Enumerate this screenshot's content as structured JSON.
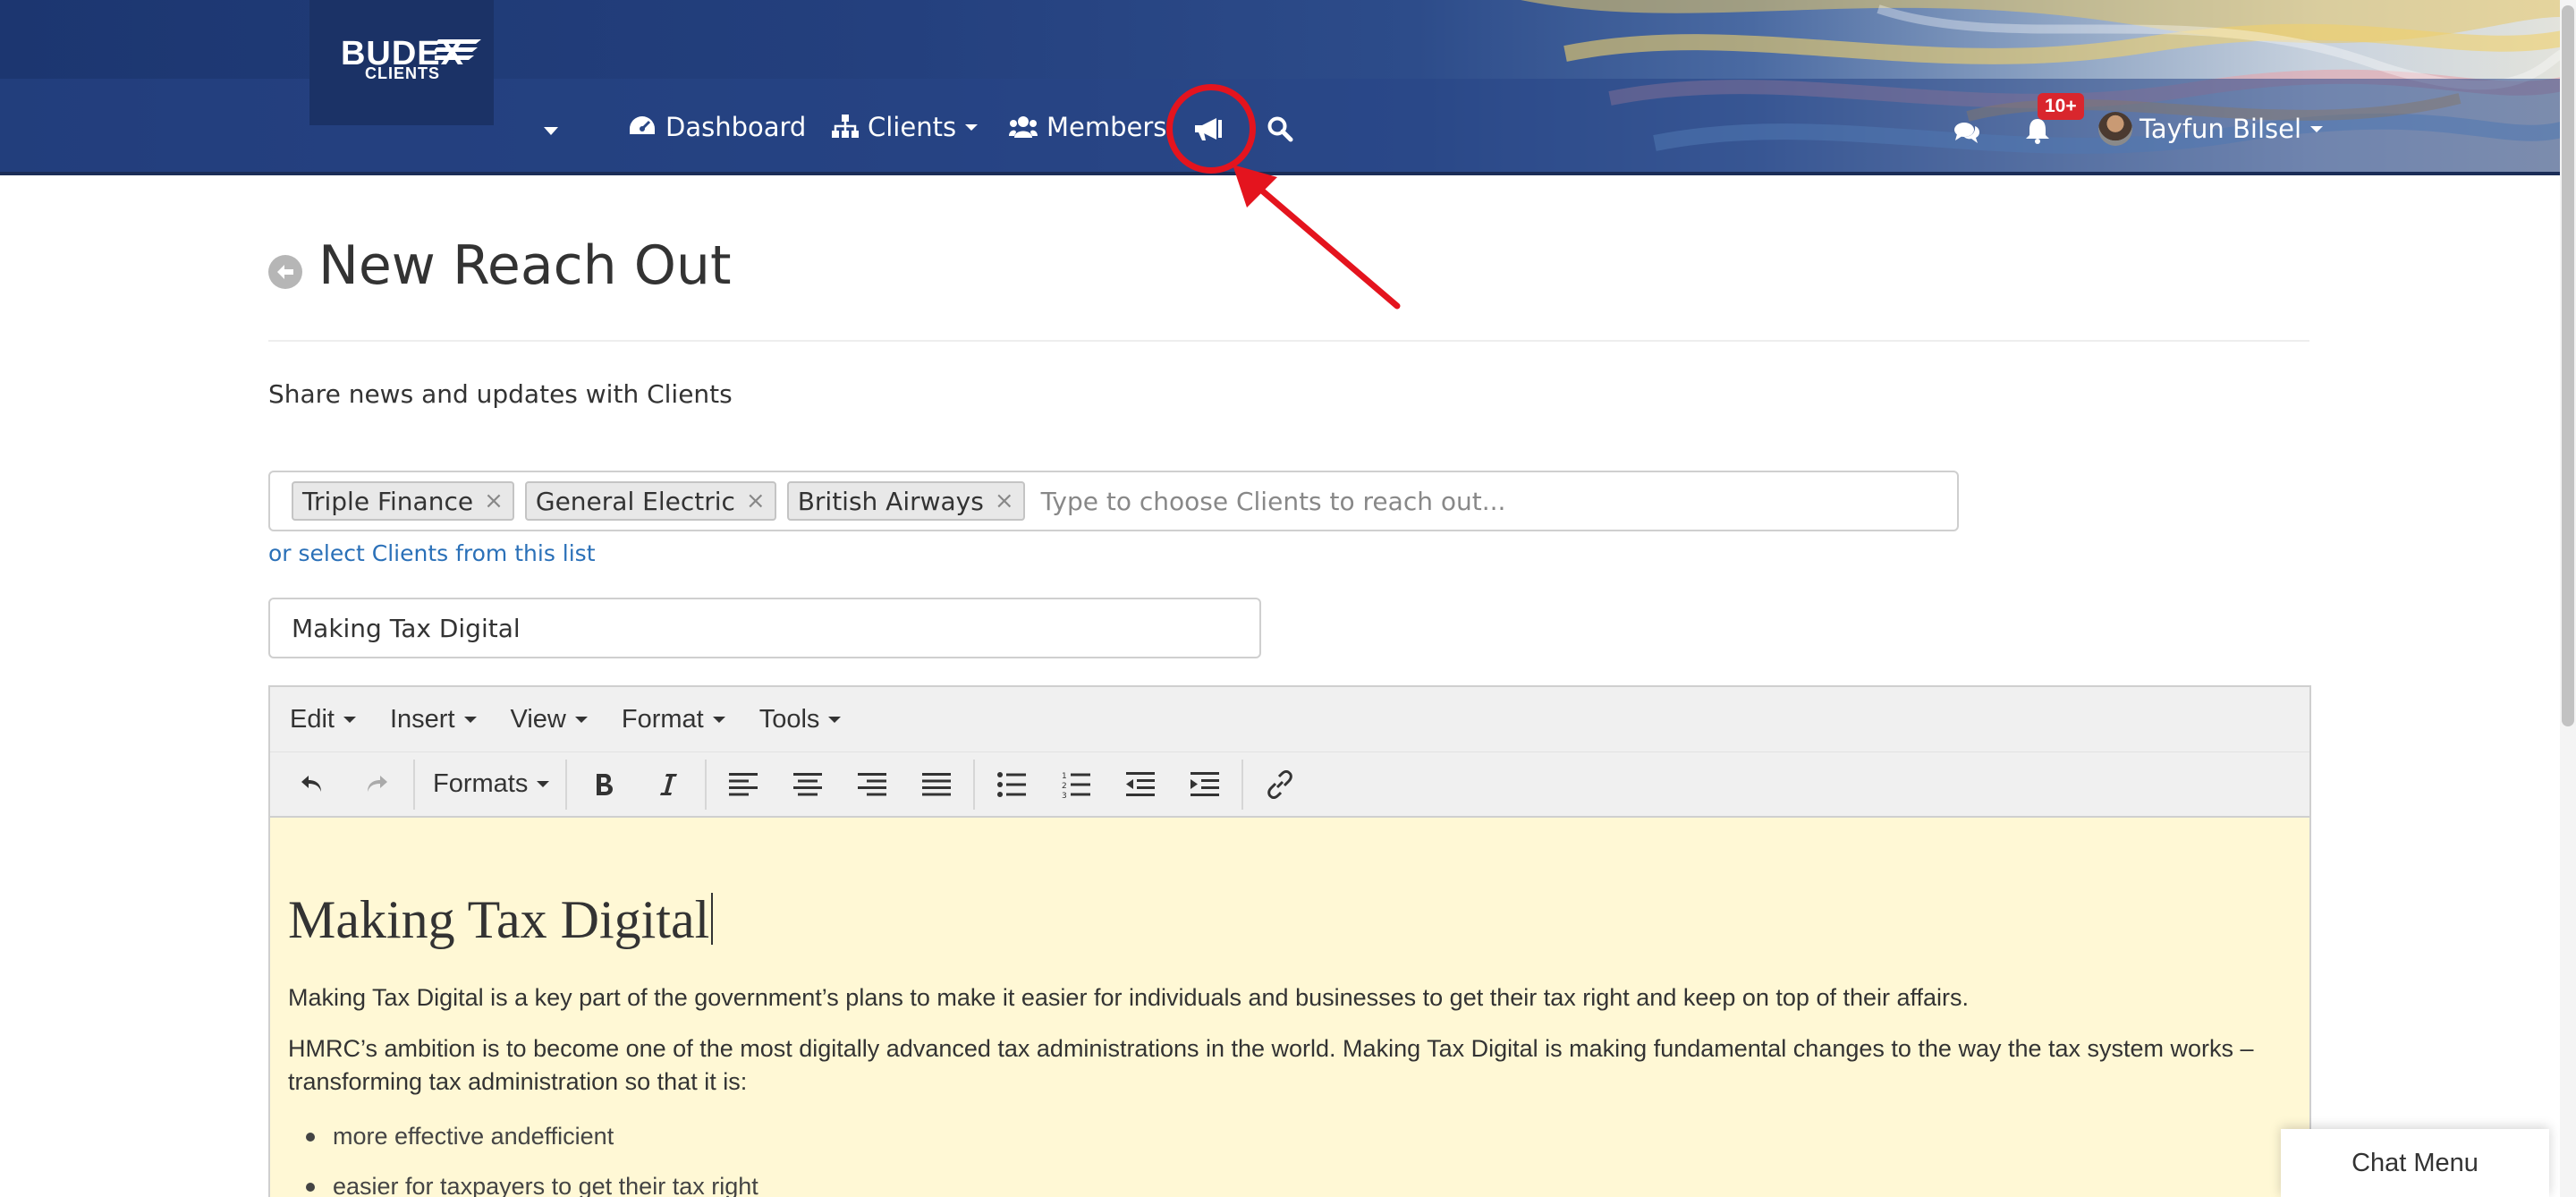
{
  "brand": {
    "name": "BUDEX",
    "sub": "CLIENTS"
  },
  "nav": {
    "dashboard": "Dashboard",
    "clients": "Clients",
    "members": "Members",
    "notifications_badge": "10+",
    "user_name": "Tayfun Bilsel"
  },
  "page": {
    "title": "New Reach Out",
    "subtitle": "Share news and updates with Clients"
  },
  "recipients": {
    "tags": [
      "Triple Finance",
      "General Electric",
      "British Airways"
    ],
    "placeholder": "Type to choose Clients to reach out...",
    "select_link": "or select Clients from this list"
  },
  "subject": {
    "value": "Making Tax Digital"
  },
  "editor": {
    "menus": [
      "Edit",
      "Insert",
      "View",
      "Format",
      "Tools"
    ],
    "formats_label": "Formats",
    "heading": "Making Tax Digital",
    "paragraph1": "Making Tax Digital is a key part of the government’s plans to make it easier for individuals and businesses to get their tax right and keep on top of their affairs.",
    "paragraph2": "HMRC’s ambition is to become one of the most digitally advanced tax administrations in the world. Making Tax Digital is making fundamental changes to the way the tax system works – transforming tax administration so that it is:",
    "list": [
      "more effective andefficient",
      "easier for taxpayers to get their tax right"
    ]
  },
  "chat": {
    "label": "Chat Menu"
  },
  "icons": {
    "dashboard": "tachometer-icon",
    "clients": "sitemap-icon",
    "members": "users-icon",
    "reach_out": "bullhorn-icon",
    "search": "search-icon",
    "chat": "comments-icon",
    "notifications": "bell-icon",
    "back": "circle-arrow-left-icon"
  },
  "colors": {
    "navbar": "#24407e",
    "annotation": "#e4141e",
    "link": "#2a70b8",
    "editor_bg": "#fff8d5",
    "badge": "#d9262d"
  }
}
